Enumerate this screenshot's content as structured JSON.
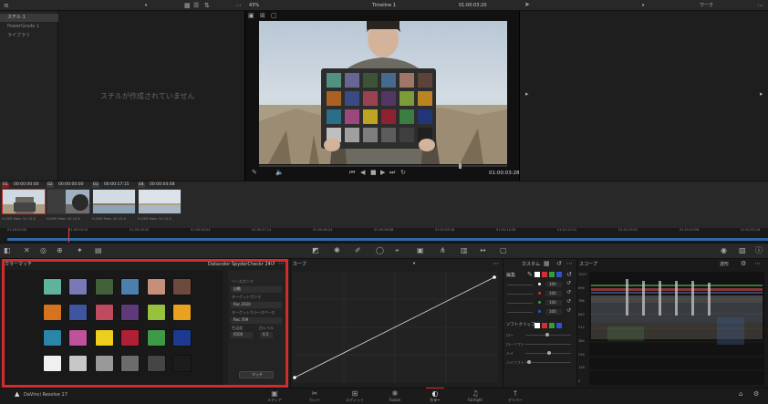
{
  "top_left": {
    "album_label": "スチル 1",
    "powergrade_label": "PowerGrade 1",
    "library_label": "ライブラリ",
    "empty_message": "スチルが作成されていません"
  },
  "viewer": {
    "zoom": "43%",
    "timeline_name": "Timeline 1",
    "header_timecode": "01:00:03:20",
    "timecode": "01:00:03:28"
  },
  "right_header": {
    "dropdown": "ワーク"
  },
  "clips": [
    {
      "num": "01",
      "tc": "00:00:00:00",
      "format": "H.265 Main 10 L5.0"
    },
    {
      "num": "02",
      "tc": "00:00:00:00",
      "format": "H.265 Main 10 L5.0"
    },
    {
      "num": "03",
      "tc": "00:00:17:15",
      "format": "H.265 Main 10 L5.0"
    },
    {
      "num": "04",
      "tc": "00:00:04:08",
      "format": "H.265 Main 10 L5.0"
    }
  ],
  "ruler_marks": [
    "01:00:00:00",
    "01:00:09:10",
    "01:00:18:20",
    "01:00:28:04",
    "01:00:37:14",
    "01:00:46:24",
    "01:00:56:08",
    "01:01:05:18",
    "01:01:14:28",
    "01:01:24:12",
    "01:01:33:22",
    "01:01:43:06",
    "01:01:52:16"
  ],
  "color_chart": {
    "header": "カラーマッチ",
    "dropdown": "Datacolor SpyderCheckr 24",
    "source_gamma_label": "ソースガンマ",
    "source_gamma_value": "自動",
    "target_gamma_label": "ターゲットガンマ",
    "target_gamma_value": "Rec.2020",
    "target_space_label": "ターゲットカラースペース",
    "target_space_value": "Rec.709",
    "white_temp_label": "色温度",
    "white_level_label": "白レベル",
    "white_temp_value": "6500",
    "white_level_value": "0.5",
    "match_button": "マッチ",
    "swatches": [
      "#5fb39c",
      "#7b78b6",
      "#42613a",
      "#4d7fad",
      "#c58f7b",
      "#6e4a3e",
      "#d6731f",
      "#3f55a1",
      "#c04a5f",
      "#5e3a7a",
      "#97c23e",
      "#e8a21d",
      "#2a86a6",
      "#c0529b",
      "#edcd1d",
      "#b01f34",
      "#3f9a48",
      "#1d3a91",
      "#f0f0f0",
      "#c7c7c7",
      "#999999",
      "#6c6c6c",
      "#454545",
      "#1c1c1c"
    ]
  },
  "curves": {
    "title": "カーブ"
  },
  "color_wheels": {
    "title": "カスタム",
    "edit_label": "編集",
    "rows": [
      {
        "label": "Y",
        "value": "100"
      },
      {
        "label": "R",
        "value": "100"
      },
      {
        "label": "G",
        "value": "100"
      },
      {
        "label": "B",
        "value": "100"
      }
    ],
    "soft_clip_label": "ソフトクリップ",
    "low_label": "ロー",
    "low_soft_label": "ローソフト",
    "high_label": "ハイ",
    "high_soft_label": "ハイソフト"
  },
  "scopes": {
    "title": "スコープ",
    "dropdown": "波形",
    "scale": [
      "1023",
      "896",
      "768",
      "640",
      "512",
      "384",
      "256",
      "128",
      "0"
    ]
  },
  "bottom_tabs": [
    "メディア",
    "カット",
    "エディット",
    "Fusion",
    "カラー",
    "Fairlight",
    "デリバー"
  ],
  "app_name": "DaVinci Resolve 17",
  "colors": {
    "accent": "#d12b2b",
    "bg": "#1e1e1e",
    "panel": "#282828",
    "timeline_marker": "#e64444"
  }
}
